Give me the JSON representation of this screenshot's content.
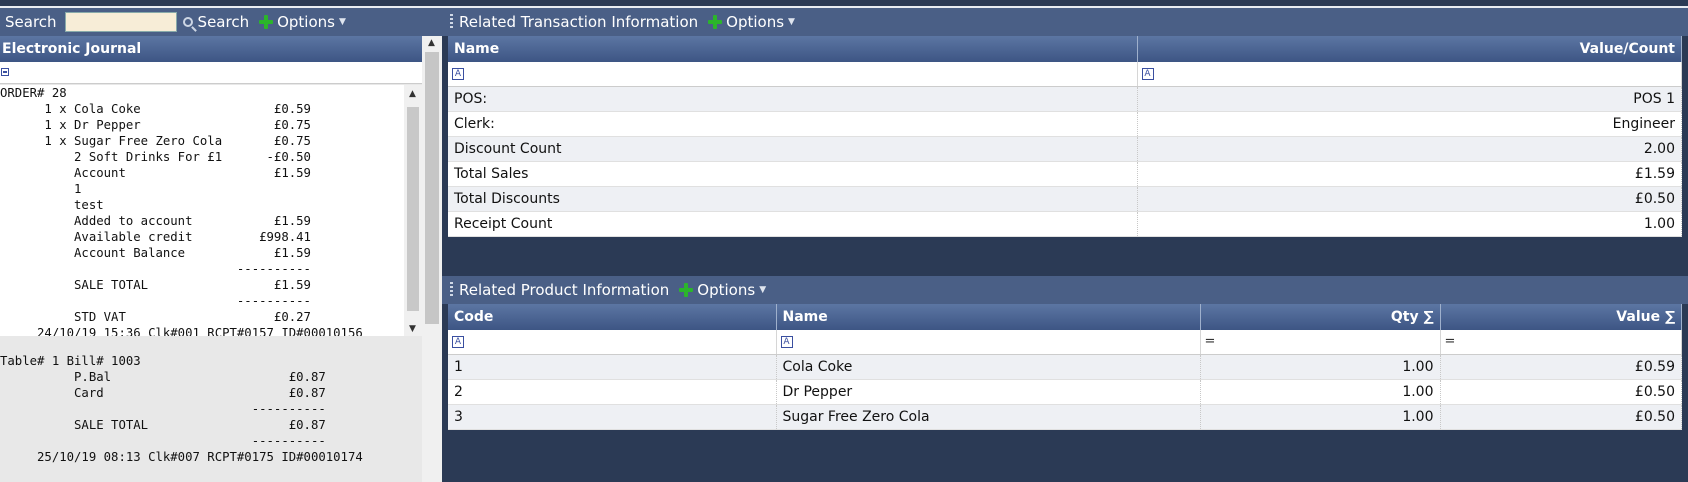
{
  "left_toolbar": {
    "search_label": "Search",
    "search_value": "",
    "search_button": "Search",
    "options_label": "Options"
  },
  "journal": {
    "title": "Electronic Journal",
    "receipt1": "ORDER# 28\n      1 x Cola Coke                  £0.59\n      1 x Dr Pepper                  £0.75\n      1 x Sugar Free Zero Cola       £0.75\n          2 Soft Drinks For £1      -£0.50\n          Account                    £1.59\n          1\n          test\n          Added to account           £1.59\n          Available credit         £998.41\n          Account Balance            £1.59\n                                ----------\n          SALE TOTAL                 £1.59\n                                ----------\n          STD VAT                    £0.27\n     24/10/19 15:36 Clk#001 RCPT#0157 ID#00010156",
    "receipt2": "Table# 1 Bill# 1003\n          P.Bal                        £0.87\n          Card                         £0.87\n                                  ----------\n          SALE TOTAL                   £0.87\n                                  ----------\n     25/10/19 08:13 Clk#007 RCPT#0175 ID#00010174"
  },
  "transaction": {
    "title": "Related Transaction Information",
    "options_label": "Options",
    "columns": {
      "name": "Name",
      "value": "Value/Count"
    },
    "rows": [
      {
        "name": "POS:",
        "value": "POS 1"
      },
      {
        "name": "Clerk:",
        "value": "Engineer"
      },
      {
        "name": "Discount Count",
        "value": "2.00"
      },
      {
        "name": "Total Sales",
        "value": "£1.59"
      },
      {
        "name": "Total Discounts",
        "value": "£0.50"
      },
      {
        "name": "Receipt Count",
        "value": "1.00"
      }
    ]
  },
  "product": {
    "title": "Related Product Information",
    "options_label": "Options",
    "columns": {
      "code": "Code",
      "name": "Name",
      "qty": "Qty ∑",
      "value": "Value ∑"
    },
    "rows": [
      {
        "code": "1",
        "name": "Cola Coke",
        "qty": "1.00",
        "value": "£0.59"
      },
      {
        "code": "2",
        "name": "Dr Pepper",
        "qty": "1.00",
        "value": "£0.50"
      },
      {
        "code": "3",
        "name": "Sugar Free Zero Cola",
        "qty": "1.00",
        "value": "£0.50"
      }
    ]
  },
  "icons": {
    "filter_text": "A",
    "filter_equals": "=",
    "scroll_up": "▲",
    "scroll_down": "▼",
    "dropdown": "▼"
  },
  "colors": {
    "header": "#4a5f86",
    "background": "#2b3a55",
    "add_icon": "#2bb52b",
    "search_input": "#f7edd7"
  }
}
